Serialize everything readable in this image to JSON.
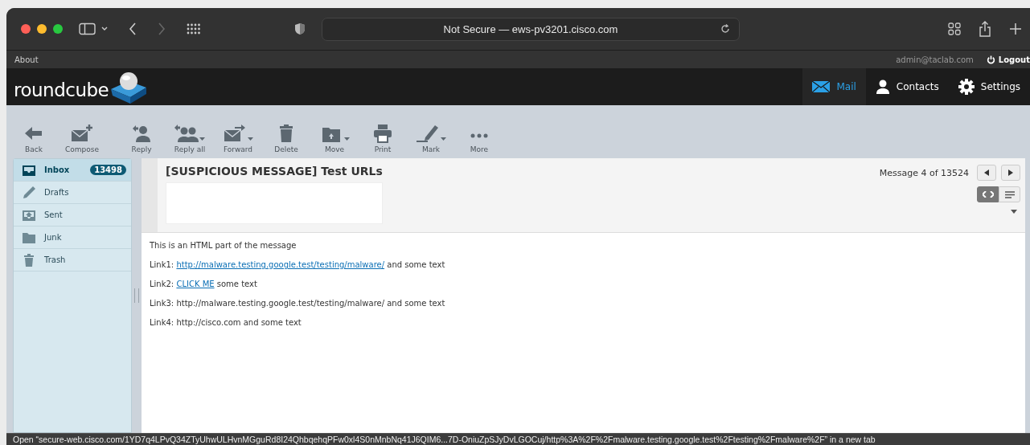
{
  "browser": {
    "address": "Not Secure — ews-pv3201.cisco.com"
  },
  "topbar": {
    "about": "About",
    "user": "admin@taclab.com",
    "logout": "Logout"
  },
  "header": {
    "logo": "roundcube",
    "nav": [
      {
        "label": "Mail",
        "selected": true
      },
      {
        "label": "Contacts",
        "selected": false
      },
      {
        "label": "Settings",
        "selected": false
      }
    ]
  },
  "toolbar": [
    {
      "label": "Back",
      "has_menu": false
    },
    {
      "label": "Compose",
      "has_menu": false
    },
    {
      "label": "Reply",
      "has_menu": false
    },
    {
      "label": "Reply all",
      "has_menu": true
    },
    {
      "label": "Forward",
      "has_menu": true
    },
    {
      "label": "Delete",
      "has_menu": false
    },
    {
      "label": "Move",
      "has_menu": true
    },
    {
      "label": "Print",
      "has_menu": false
    },
    {
      "label": "Mark",
      "has_menu": true
    },
    {
      "label": "More",
      "has_menu": false
    }
  ],
  "folders": [
    {
      "name": "Inbox",
      "selected": true,
      "unread": "13498"
    },
    {
      "name": "Drafts",
      "selected": false
    },
    {
      "name": "Sent",
      "selected": false
    },
    {
      "name": "Junk",
      "selected": false
    },
    {
      "name": "Trash",
      "selected": false
    }
  ],
  "message": {
    "subject": "[SUSPICIOUS MESSAGE] Test URLs",
    "counter": "Message 4 of 13524",
    "view_modes": [
      {
        "kind": "html",
        "selected": true
      },
      {
        "kind": "plain",
        "selected": false
      }
    ],
    "body": [
      {
        "segments": [
          {
            "kind": "text",
            "text": "This is an HTML part of the message"
          }
        ]
      },
      {
        "segments": [
          {
            "kind": "text",
            "text": "Link1:"
          },
          {
            "kind": "link",
            "text": "http://malware.testing.google.test/testing/malware/"
          },
          {
            "kind": "text",
            "text": "and some text"
          }
        ]
      },
      {
        "segments": [
          {
            "kind": "text",
            "text": "Link2:"
          },
          {
            "kind": "link",
            "text": "CLICK ME"
          },
          {
            "kind": "text",
            "text": "some text"
          }
        ]
      },
      {
        "segments": [
          {
            "kind": "text",
            "text": "Link3: http://malware.testing.google.test/testing/malware/ and some text"
          }
        ]
      },
      {
        "segments": [
          {
            "kind": "text",
            "text": "Link4: http://cisco.com and some text"
          }
        ]
      }
    ]
  },
  "status_bar": "Open “secure-web.cisco.com/1YD7q4LPvQ34ZTyUhwULHvnMGguRd8I24QhbqehqPFw0xl4S0nMnbNq41J6QIM6...7D-OniuZpSJyDvLGOCuj/http%3A%2F%2Fmalware.testing.google.test%2Ftesting%2Fmalware%2F” in a new tab"
}
